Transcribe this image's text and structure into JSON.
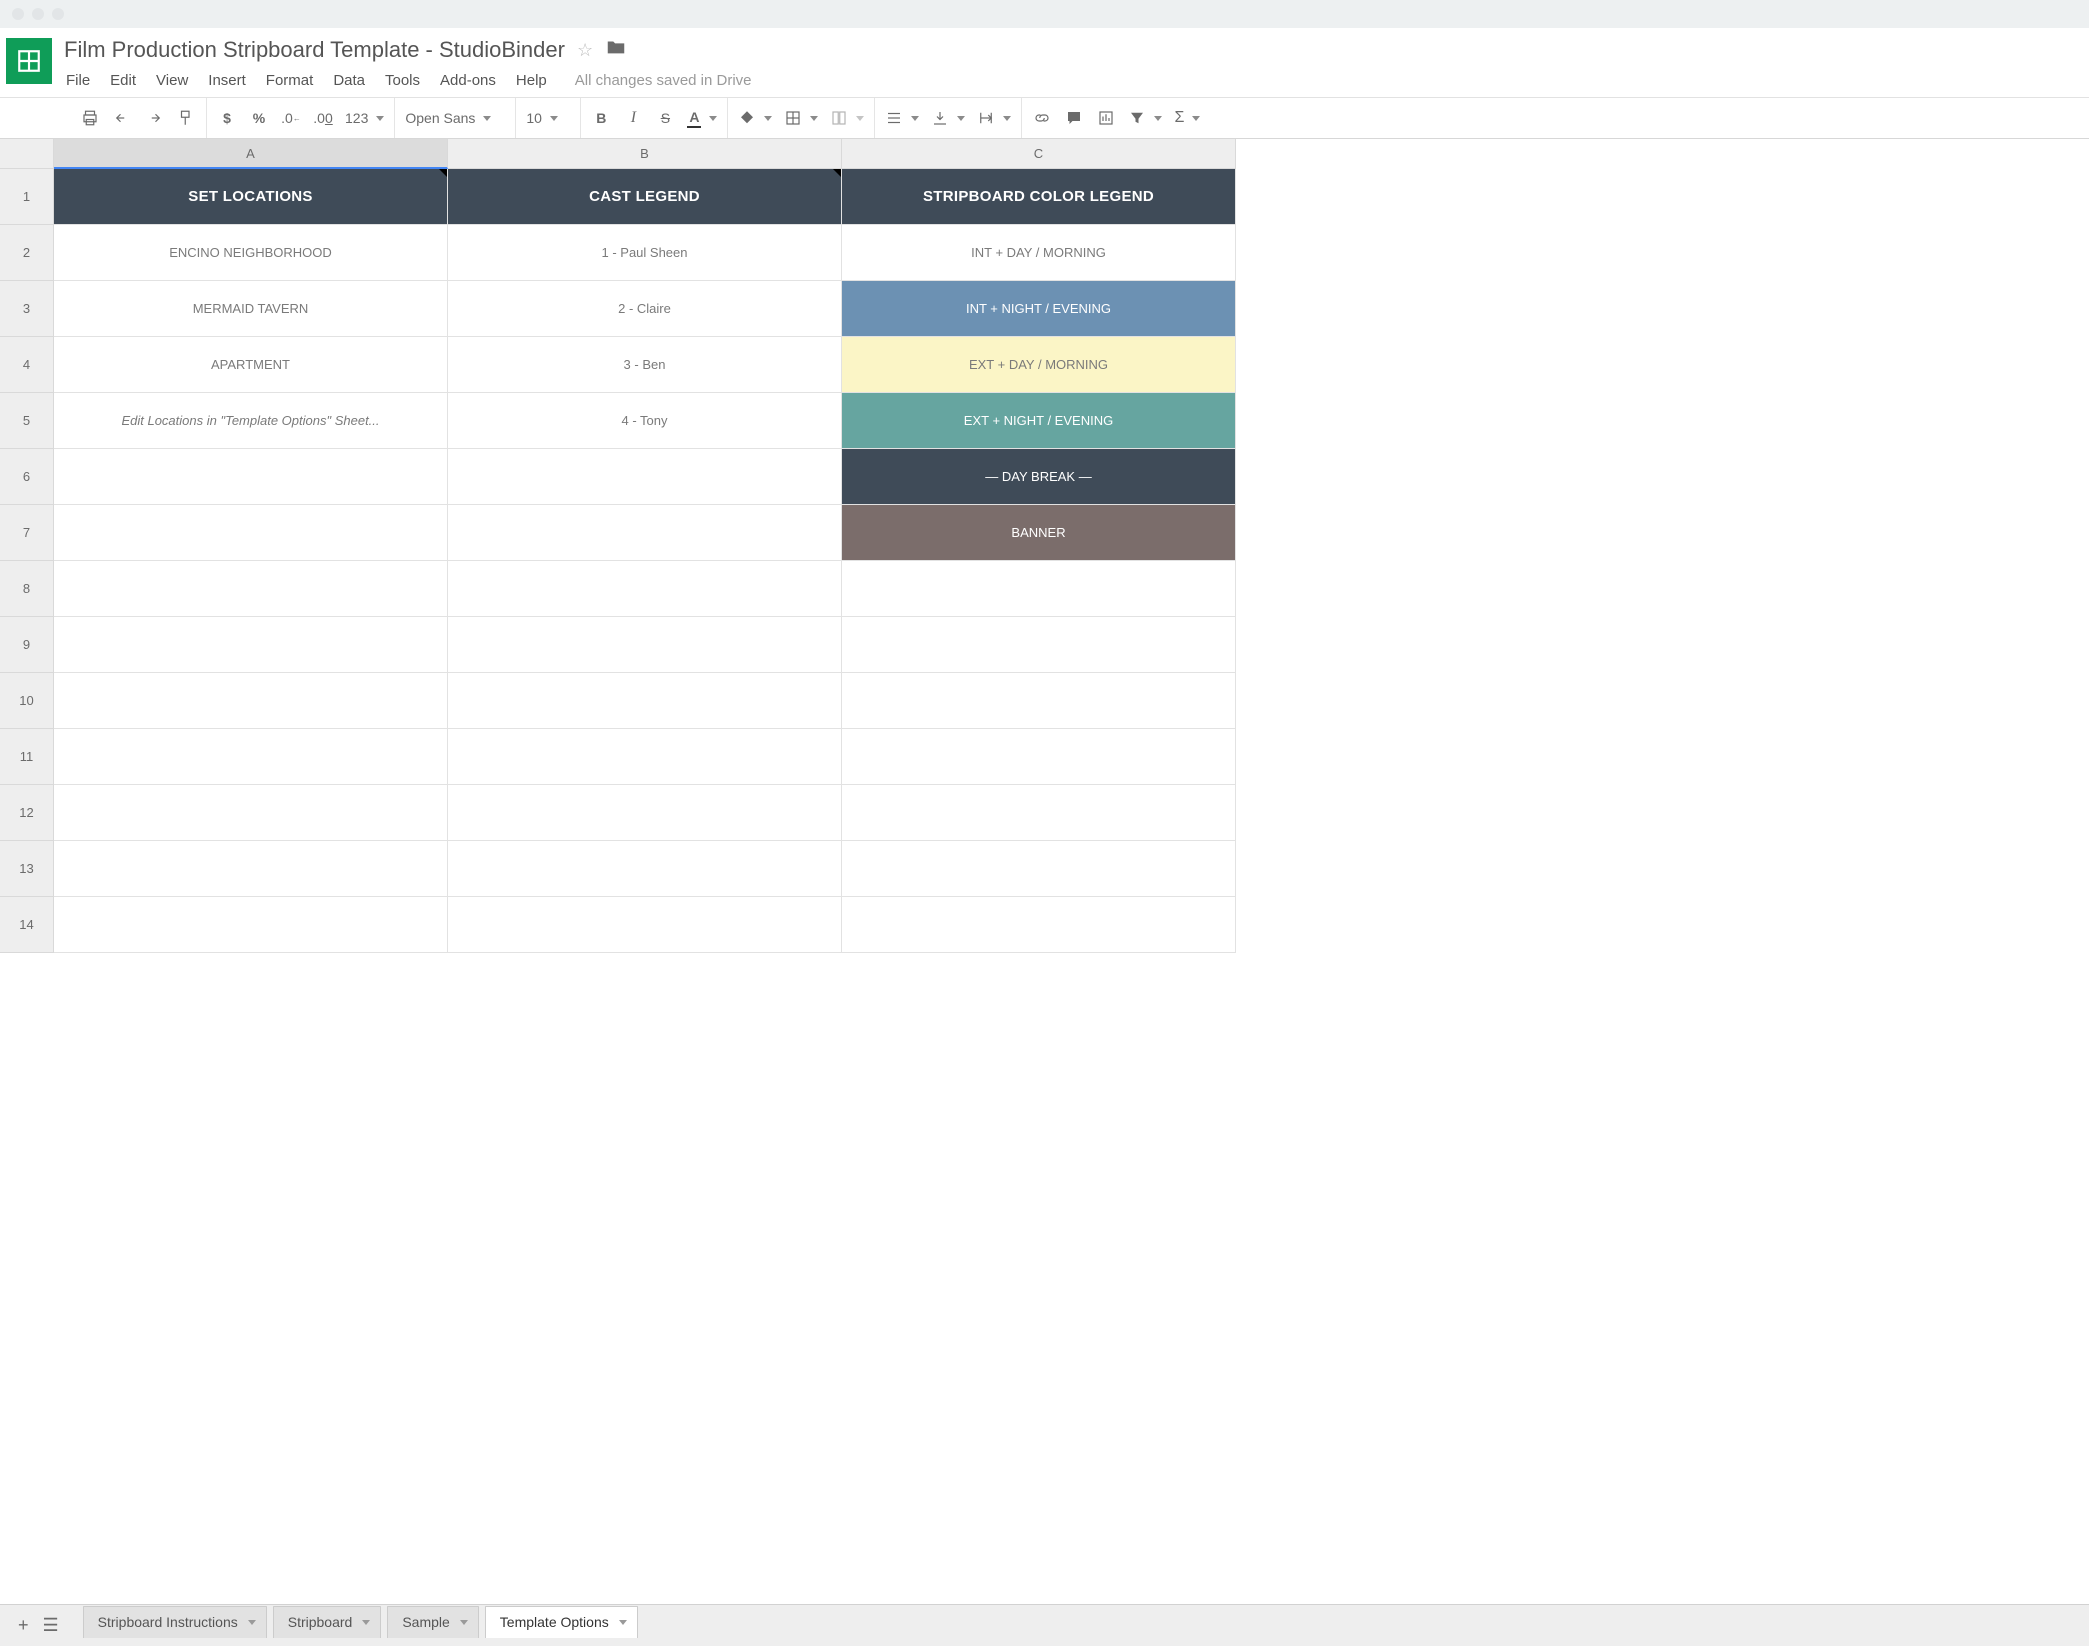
{
  "doc": {
    "title": "Film Production Stripboard Template  -  StudioBinder"
  },
  "menu": {
    "file": "File",
    "edit": "Edit",
    "view": "View",
    "insert": "Insert",
    "format": "Format",
    "data": "Data",
    "tools": "Tools",
    "addons": "Add-ons",
    "help": "Help",
    "save_status": "All changes saved in Drive"
  },
  "toolbar": {
    "currency": "$",
    "percent": "%",
    "dec_less": ".0  ",
    "dec_more": ".00",
    "num_format": "123",
    "font": "Open Sans",
    "font_size": "10",
    "bold": "B",
    "italic": "I",
    "strike": "S",
    "text_color": "A",
    "sigma": "Σ"
  },
  "columns": [
    "A",
    "B",
    "C"
  ],
  "row_numbers": [
    "1",
    "2",
    "3",
    "4",
    "5",
    "6",
    "7",
    "8",
    "9",
    "10",
    "11",
    "12",
    "13",
    "14"
  ],
  "headers": {
    "A": "SET LOCATIONS",
    "B": "CAST LEGEND",
    "C": "STRIPBOARD COLOR LEGEND"
  },
  "rows": [
    {
      "A": "ENCINO NEIGHBORHOOD",
      "B": "1 - Paul Sheen",
      "C": {
        "label": "INT  +  DAY / MORNING",
        "bg": "#ffffff",
        "fg": "#7a7a7a"
      }
    },
    {
      "A": "MERMAID TAVERN",
      "B": "2 - Claire",
      "C": {
        "label": "INT  +  NIGHT / EVENING",
        "bg": "#6c91b3",
        "fg": "#ffffff"
      }
    },
    {
      "A": "APARTMENT",
      "B": "3 - Ben",
      "C": {
        "label": "EXT  +  DAY / MORNING",
        "bg": "#fbf5c6",
        "fg": "#7a7a7a"
      }
    },
    {
      "A": "Edit Locations in \"Template Options\" Sheet...",
      "A_italic": true,
      "B": "4 - Tony",
      "C": {
        "label": "EXT  +  NIGHT / EVENING",
        "bg": "#66a5a0",
        "fg": "#ffffff"
      }
    },
    {
      "A": "",
      "B": "",
      "C": {
        "label": "— DAY BREAK —",
        "bg": "#3f4b58",
        "fg": "#ffffff"
      }
    },
    {
      "A": "",
      "B": "",
      "C": {
        "label": "BANNER",
        "bg": "#7b6d6b",
        "fg": "#ffffff"
      }
    }
  ],
  "tabs": {
    "t0": "Stripboard Instructions",
    "t1": "Stripboard",
    "t2": "Sample",
    "t3": "Template Options"
  }
}
